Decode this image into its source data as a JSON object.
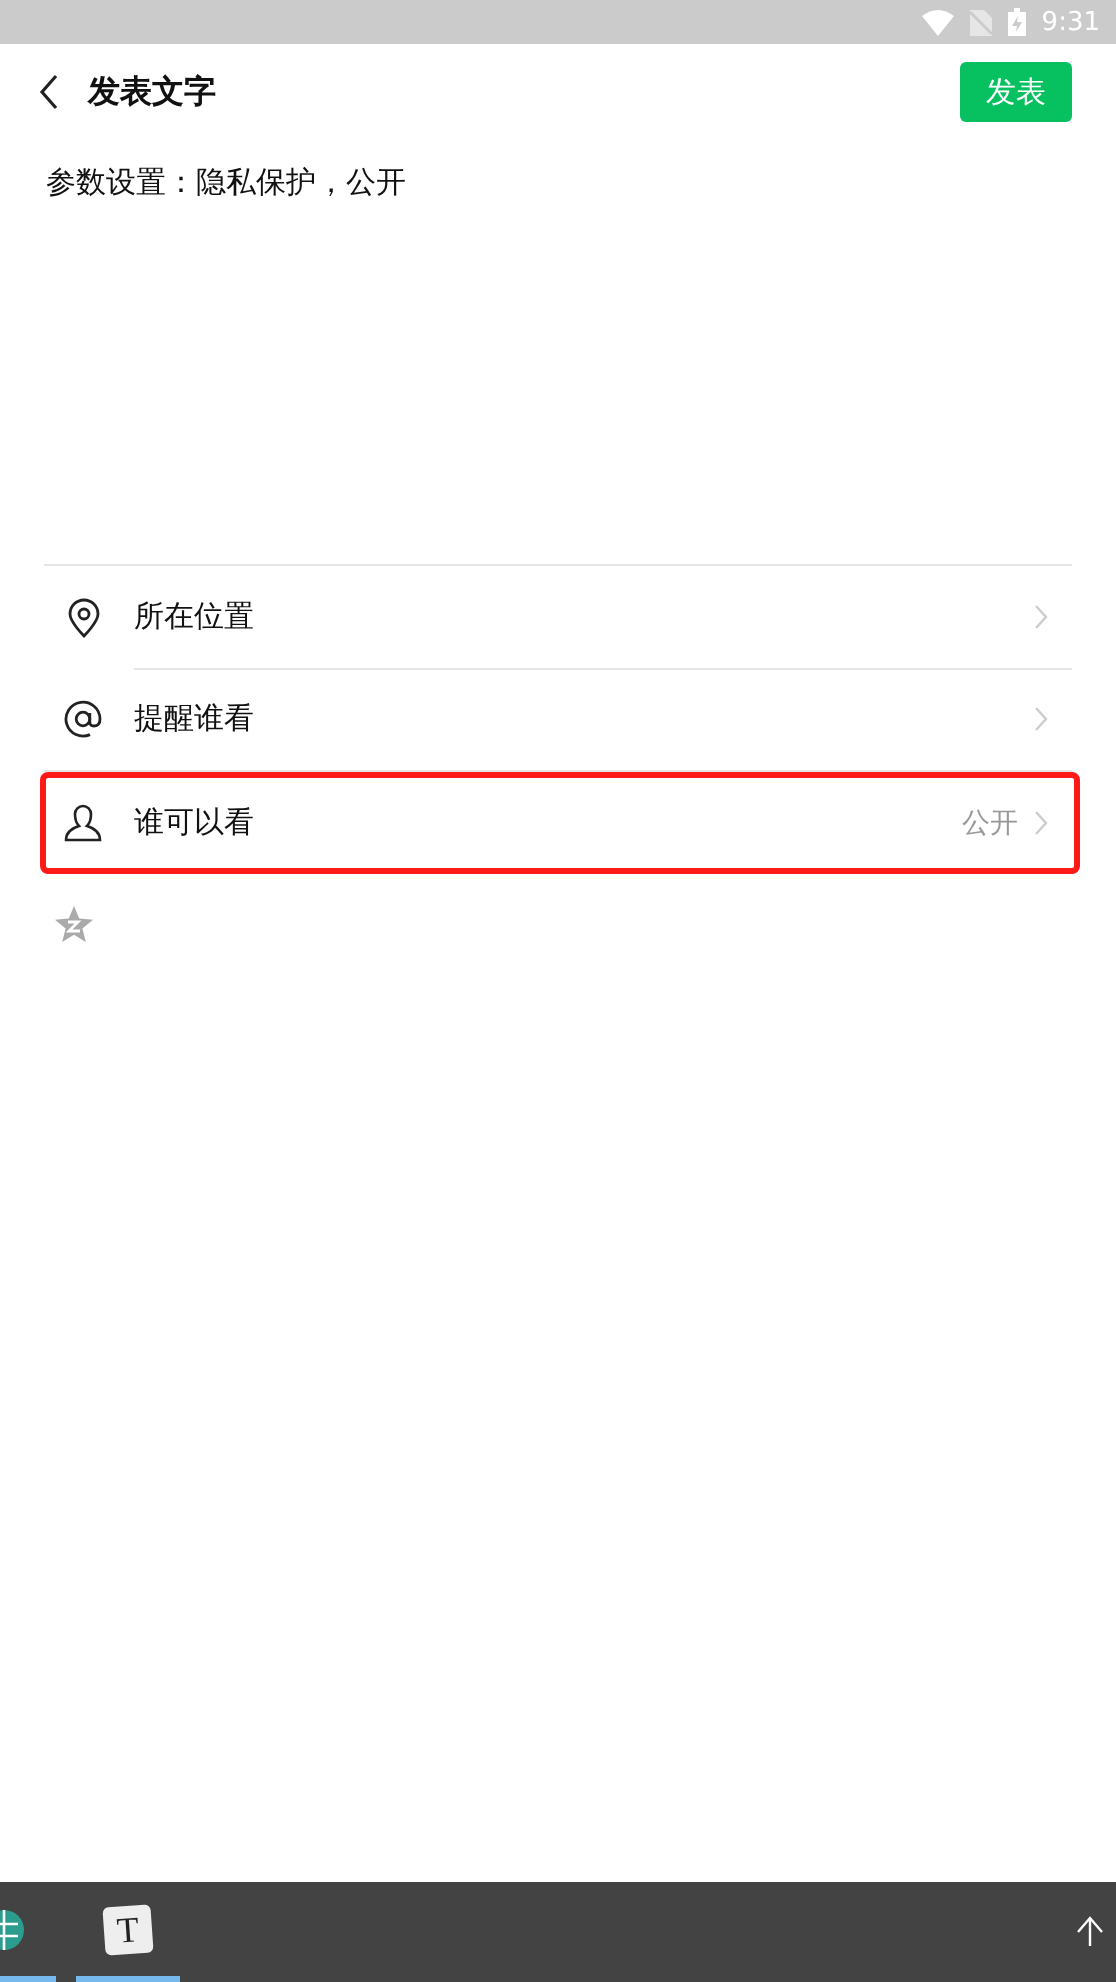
{
  "status_bar": {
    "time": "9:31"
  },
  "header": {
    "title": "发表文字",
    "publish_button": "发表"
  },
  "post_text": "参数设置：隐私保护，公开",
  "options": [
    {
      "kind": "location",
      "label": "所在位置",
      "highlighted": false
    },
    {
      "kind": "mention",
      "label": "提醒谁看",
      "highlighted": false
    },
    {
      "kind": "visibility",
      "label": "谁可以看",
      "value": "公开",
      "highlighted": true
    }
  ],
  "taskbar": {
    "apps": [
      {
        "kind": "globe",
        "active": true
      },
      {
        "kind": "letter",
        "label": "T",
        "active": true
      }
    ]
  }
}
